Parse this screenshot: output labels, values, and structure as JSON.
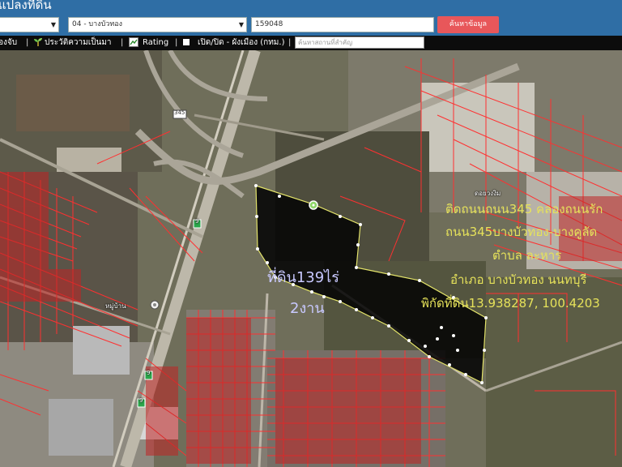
{
  "header": {
    "title": "แปลงที่ดิน",
    "select1": {
      "value": ""
    },
    "select2": {
      "value": "04 - บางบัวทอง"
    },
    "parcel_input": {
      "value": "159048"
    },
    "search_button": "ค้นหาข้อมูล"
  },
  "toolbar": {
    "item1": "องจับ",
    "item2": "ประวัติความเป็นมา",
    "item3": "Rating",
    "item4": "เปิด/ปิด - ผังเมือง (กทม.)",
    "search_placeholder": "ค้นหาสถานที่สำคัญ"
  },
  "map": {
    "land_label_line1": "ที่ดิน139ไร่",
    "land_label_line2": "2งาน",
    "info_lines": [
      "ติดถนนถนน345 คลองถนนรัก",
      "ถนน345บางบัวทอง-บางคูลัด",
      "ตำบล ละหาร",
      "อำเภอ บางบัวทอง นนทบุรี",
      "พิกัดที่ดิน13.938287, 100.4203"
    ],
    "poi_labels": [
      "ดอยวงงิม",
      "หมู่บ้าน"
    ],
    "road_shields": [
      "9",
      "9",
      "9",
      "345"
    ]
  },
  "colors": {
    "header_bg": "#2f6ea5",
    "search_button_bg": "#e8575a",
    "toolbar_bg": "#0c0c0c",
    "parcel_line": "#ff3030",
    "land_polygon_fill": "#050505",
    "land_polygon_stroke": "#e3e36a",
    "info_text": "#e6e25a",
    "land_label_text": "#c9c9ff"
  }
}
